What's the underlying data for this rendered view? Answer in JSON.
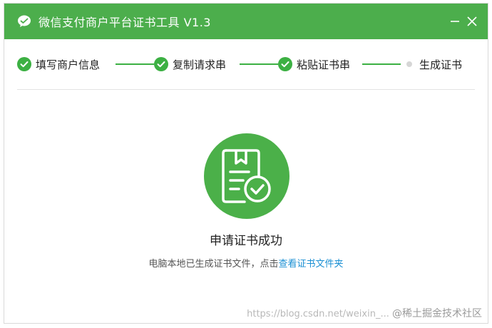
{
  "window": {
    "title": "微信支付商户平台证书工具 V1.3",
    "accent_color": "#4cae4c"
  },
  "steps": [
    {
      "label": "填写商户信息",
      "status": "done"
    },
    {
      "label": "复制请求串",
      "status": "done"
    },
    {
      "label": "粘贴证书串",
      "status": "done"
    },
    {
      "label": "生成证书",
      "status": "current"
    }
  ],
  "result": {
    "icon": "certificate-check-icon",
    "title": "申请证书成功",
    "desc_prefix": "电脑本地已生成证书文件，点击",
    "link_label": "查看证书文件夹"
  },
  "watermark": {
    "url": "https://blog.csdn.net/weixin_...",
    "brand": "@稀土掘金技术社区"
  }
}
